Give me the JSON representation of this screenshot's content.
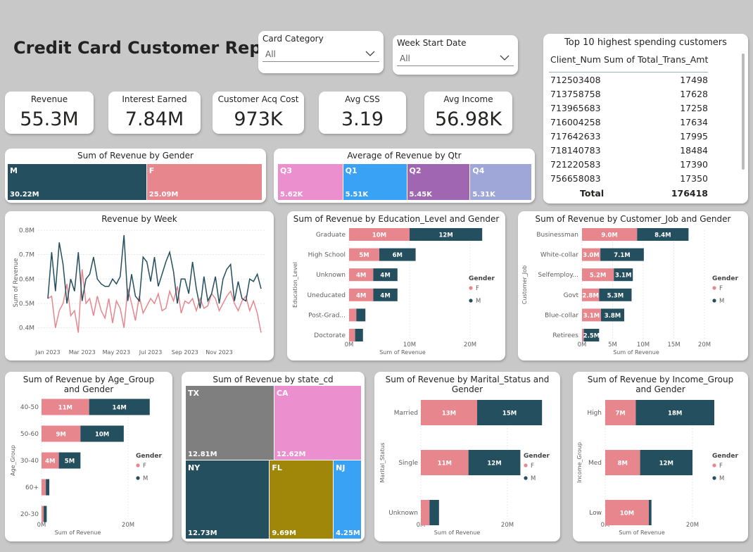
{
  "report_title": "Credit Card Customer Report",
  "slicers": {
    "card_category": {
      "label": "Card Category",
      "value": "All"
    },
    "week_start": {
      "label": "Week Start Date",
      "value": "All"
    }
  },
  "kpis": [
    {
      "label": "Revenue",
      "value": "55.3M"
    },
    {
      "label": "Interest Earned",
      "value": "7.84M"
    },
    {
      "label": "Customer Acq Cost",
      "value": "973K"
    },
    {
      "label": "Avg CSS",
      "value": "3.19"
    },
    {
      "label": "Avg Income",
      "value": "56.98K"
    }
  ],
  "top10": {
    "title": "Top 10 highest spending customers",
    "col1": "Client_Num",
    "col2": "Sum of Total_Trans_Amt",
    "rows": [
      {
        "id": "712503408",
        "amt": "17498"
      },
      {
        "id": "713758758",
        "amt": "17628"
      },
      {
        "id": "713965683",
        "amt": "17258"
      },
      {
        "id": "716004258",
        "amt": "17634"
      },
      {
        "id": "717642633",
        "amt": "17995"
      },
      {
        "id": "718140783",
        "amt": "18484"
      },
      {
        "id": "721220583",
        "amt": "17390"
      },
      {
        "id": "756658083",
        "amt": "17350"
      }
    ],
    "total_label": "Total",
    "total_value": "176418"
  },
  "colors": {
    "female": "#e8868e",
    "male": "#244f5e",
    "q3": "#ec8fcf",
    "q1": "#3aa2f5",
    "q2": "#a066b2",
    "q4": "#9fa7d8",
    "tx": "#7f7f7f",
    "ca": "#ec8fcf",
    "ny": "#244f5e",
    "fl": "#a0870a",
    "nj": "#3aa2f5"
  },
  "gender_chart": {
    "title": "Sum of Revenue by Gender",
    "segments": [
      {
        "label": "M",
        "value_label": "30.22M",
        "value": 30.22,
        "color": "#244f5e"
      },
      {
        "label": "F",
        "value_label": "25.09M",
        "value": 25.09,
        "color": "#e8868e"
      }
    ]
  },
  "qtr_chart": {
    "title": "Average of Revenue by Qtr",
    "segments": [
      {
        "label": "Q3",
        "value_label": "5.62K",
        "value": 5.62,
        "color": "#ec8fcf"
      },
      {
        "label": "Q1",
        "value_label": "5.51K",
        "value": 5.51,
        "color": "#3aa2f5"
      },
      {
        "label": "Q2",
        "value_label": "5.45K",
        "value": 5.45,
        "color": "#a066b2"
      },
      {
        "label": "Q4",
        "value_label": "5.31K",
        "value": 5.31,
        "color": "#9fa7d8"
      }
    ]
  },
  "week_chart": {
    "title": "Revenue by Week",
    "ylabel": "Sum of Revenue",
    "yticks": [
      "0.8M",
      "0.7M",
      "0.6M",
      "0.5M",
      "0.4M"
    ],
    "xticks": [
      "Jan 2023",
      "Mar 2023",
      "May 2023",
      "Jul 2023",
      "Sep 2023",
      "Nov 2023"
    ]
  },
  "chart_data": [
    {
      "type": "line",
      "title": "Revenue by Week",
      "ylabel": "Sum of Revenue",
      "ylim": [
        0.37,
        0.8
      ],
      "series": [
        {
          "color": "#244f5e",
          "values": [
            0.52,
            0.71,
            0.55,
            0.75,
            0.66,
            0.5,
            0.6,
            0.55,
            0.71,
            0.51,
            0.6,
            0.62,
            0.69,
            0.6,
            0.58,
            0.57,
            0.57,
            0.6,
            0.58,
            0.61,
            0.78,
            0.51,
            0.62,
            0.53,
            0.51,
            0.69,
            0.67,
            0.59,
            0.69,
            0.57,
            0.62,
            0.67,
            0.71,
            0.63,
            0.5,
            0.6,
            0.6,
            0.54,
            0.67,
            0.56,
            0.48,
            0.61,
            0.51,
            0.54,
            0.61,
            0.5,
            0.6,
            0.64,
            0.66,
            0.51,
            0.59,
            0.52,
            0.51,
            0.6,
            0.59,
            0.62,
            0.56
          ]
        },
        {
          "color": "#e8868e",
          "values": [
            0.52,
            0.53,
            0.4,
            0.47,
            0.5,
            0.58,
            0.45,
            0.47,
            0.38,
            0.64,
            0.5,
            0.52,
            0.45,
            0.53,
            0.47,
            0.44,
            0.52,
            0.42,
            0.51,
            0.48,
            0.4,
            0.56,
            0.5,
            0.43,
            0.53,
            0.46,
            0.49,
            0.52,
            0.5,
            0.54,
            0.47,
            0.48,
            0.55,
            0.51,
            0.57,
            0.46,
            0.51,
            0.5,
            0.52,
            0.47,
            0.52,
            0.48,
            0.49,
            0.54,
            0.52,
            0.47,
            0.5,
            0.53,
            0.55,
            0.5,
            0.47,
            0.51,
            0.53,
            0.47,
            0.51,
            0.46,
            0.38
          ]
        }
      ],
      "xticks": [
        "Jan 2023",
        "Mar 2023",
        "May 2023",
        "Jul 2023",
        "Sep 2023",
        "Nov 2023"
      ]
    },
    {
      "type": "bar",
      "title": "Sum of Revenue by Education_Level and Gender",
      "ylabel": "Education_Level",
      "xlabel": "Sum of Revenue",
      "categories": [
        "Graduate",
        "High School",
        "Unknown",
        "Uneducated",
        "Post-Grad...",
        "Doctorate"
      ],
      "series": [
        {
          "name": "F",
          "values": [
            10,
            5,
            4,
            4,
            1.2,
            1.0
          ],
          "labels": [
            "10M",
            "5M",
            "4M",
            "4M",
            "",
            ""
          ]
        },
        {
          "name": "M",
          "values": [
            12,
            6,
            4,
            4,
            1.5,
            1.3
          ],
          "labels": [
            "12M",
            "6M",
            "4M",
            "4M",
            "",
            ""
          ]
        }
      ],
      "xticks": [
        "0M",
        "10M",
        "20M"
      ],
      "xmax": 20,
      "legend_title": "Gender"
    },
    {
      "type": "bar",
      "title": "Sum of Revenue by Customer_Job and Gender",
      "ylabel": "Customer_Job",
      "xlabel": "Sum of Revenue",
      "categories": [
        "Businessman",
        "White-collar",
        "Selfemploy...",
        "Govt",
        "Blue-collar",
        "Retirees"
      ],
      "series": [
        {
          "name": "F",
          "values": [
            9.0,
            3.0,
            5.2,
            2.8,
            3.1,
            0.3
          ],
          "labels": [
            "9.0M",
            "3.0M",
            "5.2M",
            "2.8M",
            "3.1M",
            ""
          ]
        },
        {
          "name": "M",
          "values": [
            8.4,
            7.1,
            3.1,
            5.3,
            3.8,
            2.5
          ],
          "labels": [
            "8.4M",
            "7.1M",
            "3.1M",
            "5.3M",
            "3.8M",
            "2.5M"
          ]
        }
      ],
      "xticks": [
        "0M",
        "5M",
        "10M",
        "15M",
        "20M"
      ],
      "xmax": 20,
      "legend_title": "Gender"
    },
    {
      "type": "bar",
      "title": "Sum of Revenue by Age_Group and Gender",
      "ylabel": "Age_Group",
      "xlabel": "Sum of Revenue",
      "categories": [
        "40-50",
        "50-60",
        "30-40",
        "60+",
        "20-30"
      ],
      "series": [
        {
          "name": "F",
          "values": [
            11,
            9,
            4,
            1.0,
            0.5
          ],
          "labels": [
            "11M",
            "9M",
            "4M",
            "",
            ""
          ]
        },
        {
          "name": "M",
          "values": [
            14,
            10,
            5,
            0.8,
            0.7
          ],
          "labels": [
            "14M",
            "10M",
            "5M",
            "",
            ""
          ]
        }
      ],
      "xticks": [
        "0M",
        "20M"
      ],
      "xmax": 20,
      "legend_title": "Gender"
    },
    {
      "type": "treemap",
      "title": "Sum of Revenue by state_cd",
      "categories": [
        "TX",
        "CA",
        "NY",
        "FL",
        "NJ"
      ],
      "values": [
        12.81,
        12.62,
        12.73,
        9.69,
        4.25
      ],
      "labels": [
        "12.81M",
        "12.62M",
        "12.73M",
        "9.69M",
        "4.25M"
      ]
    },
    {
      "type": "bar",
      "title": "Sum of Revenue by Marital_Status and Gender",
      "ylabel": "Marital_Status",
      "xlabel": "Sum of Revenue",
      "categories": [
        "Married",
        "Single",
        "Unknown"
      ],
      "series": [
        {
          "name": "F",
          "values": [
            13,
            11,
            2
          ],
          "labels": [
            "13M",
            "11M",
            ""
          ]
        },
        {
          "name": "M",
          "values": [
            15,
            12,
            2.2
          ],
          "labels": [
            "15M",
            "12M",
            ""
          ]
        }
      ],
      "xticks": [
        "0M",
        "20M"
      ],
      "xmax": 20,
      "legend_title": "Gender"
    },
    {
      "type": "bar",
      "title": "Sum of Revenue by Income_Group and Gender",
      "ylabel": "Income_Group",
      "xlabel": "Sum of Revenue",
      "categories": [
        "High",
        "Med",
        "Low"
      ],
      "series": [
        {
          "name": "F",
          "values": [
            7,
            8,
            10
          ],
          "labels": [
            "7M",
            "8M",
            "10M"
          ]
        },
        {
          "name": "M",
          "values": [
            18,
            12,
            0.6
          ],
          "labels": [
            "18M",
            "12M",
            ""
          ]
        }
      ],
      "xticks": [
        "0M",
        "20M"
      ],
      "xmax": 20,
      "legend_title": "Gender"
    }
  ]
}
